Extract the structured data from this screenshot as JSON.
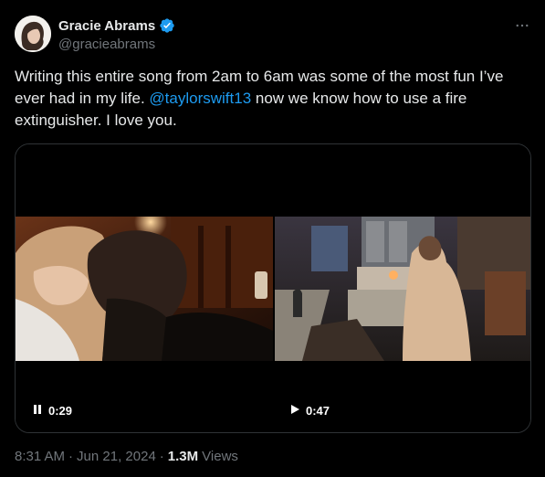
{
  "author": {
    "display_name": "Gracie Abrams",
    "handle": "@gracieabrams",
    "verified": true,
    "avatar_icon": "avatar-icon"
  },
  "tweet": {
    "text_before": "Writing this entire song from 2am to 6am was some of the most fun I’ve ever had in my life. ",
    "mention": "@taylorswift13",
    "text_after": " now we know how to use a fire extinguisher. I love you."
  },
  "media": {
    "videos": [
      {
        "state": "playing",
        "control_icon": "pause-icon",
        "duration": "0:29"
      },
      {
        "state": "paused",
        "control_icon": "play-icon",
        "duration": "0:47"
      }
    ]
  },
  "footer": {
    "time": "8:31 AM",
    "separator": "·",
    "date": "Jun 21, 2024",
    "views_count": "1.3M",
    "views_label": "Views"
  },
  "colors": {
    "background": "#000000",
    "text": "#e7e9ea",
    "secondary": "#71767b",
    "link": "#1d9bf0",
    "border": "#2f3336"
  }
}
